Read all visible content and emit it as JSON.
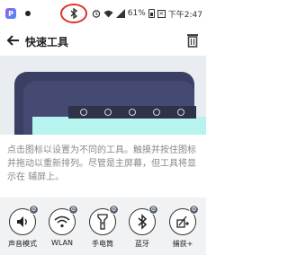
{
  "status": {
    "app_icon_letter": "P",
    "battery_percent": "61%",
    "time": "下午2:47"
  },
  "header": {
    "title": "快速工具"
  },
  "description": "点击图标以设置为不同的工具。触摸并按住图标并拖动以重新排列。尽管是主屏幕，但工具将显示在 辅屏上。",
  "tools": [
    {
      "label": "声音模式",
      "icon": "sound-icon"
    },
    {
      "label": "WLAN",
      "icon": "wifi-icon"
    },
    {
      "label": "手电筒",
      "icon": "flashlight-icon"
    },
    {
      "label": "蓝牙",
      "icon": "bluetooth-icon"
    },
    {
      "label": "捕获+",
      "icon": "capture-icon"
    }
  ],
  "colors": {
    "highlight_circle": "#e0302b",
    "phone_frame": "#3b3f63",
    "screen": "#b7f3ef"
  }
}
